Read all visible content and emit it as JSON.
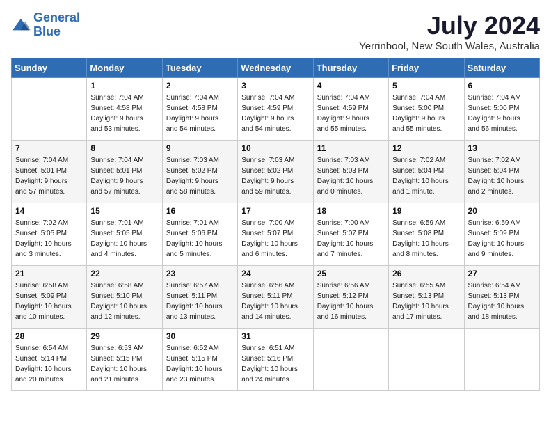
{
  "header": {
    "logo_line1": "General",
    "logo_line2": "Blue",
    "month": "July 2024",
    "location": "Yerrinbool, New South Wales, Australia"
  },
  "days_of_week": [
    "Sunday",
    "Monday",
    "Tuesday",
    "Wednesday",
    "Thursday",
    "Friday",
    "Saturday"
  ],
  "weeks": [
    [
      {
        "num": "",
        "info": ""
      },
      {
        "num": "1",
        "info": "Sunrise: 7:04 AM\nSunset: 4:58 PM\nDaylight: 9 hours\nand 53 minutes."
      },
      {
        "num": "2",
        "info": "Sunrise: 7:04 AM\nSunset: 4:58 PM\nDaylight: 9 hours\nand 54 minutes."
      },
      {
        "num": "3",
        "info": "Sunrise: 7:04 AM\nSunset: 4:59 PM\nDaylight: 9 hours\nand 54 minutes."
      },
      {
        "num": "4",
        "info": "Sunrise: 7:04 AM\nSunset: 4:59 PM\nDaylight: 9 hours\nand 55 minutes."
      },
      {
        "num": "5",
        "info": "Sunrise: 7:04 AM\nSunset: 5:00 PM\nDaylight: 9 hours\nand 55 minutes."
      },
      {
        "num": "6",
        "info": "Sunrise: 7:04 AM\nSunset: 5:00 PM\nDaylight: 9 hours\nand 56 minutes."
      }
    ],
    [
      {
        "num": "7",
        "info": "Sunrise: 7:04 AM\nSunset: 5:01 PM\nDaylight: 9 hours\nand 57 minutes."
      },
      {
        "num": "8",
        "info": "Sunrise: 7:04 AM\nSunset: 5:01 PM\nDaylight: 9 hours\nand 57 minutes."
      },
      {
        "num": "9",
        "info": "Sunrise: 7:03 AM\nSunset: 5:02 PM\nDaylight: 9 hours\nand 58 minutes."
      },
      {
        "num": "10",
        "info": "Sunrise: 7:03 AM\nSunset: 5:02 PM\nDaylight: 9 hours\nand 59 minutes."
      },
      {
        "num": "11",
        "info": "Sunrise: 7:03 AM\nSunset: 5:03 PM\nDaylight: 10 hours\nand 0 minutes."
      },
      {
        "num": "12",
        "info": "Sunrise: 7:02 AM\nSunset: 5:04 PM\nDaylight: 10 hours\nand 1 minute."
      },
      {
        "num": "13",
        "info": "Sunrise: 7:02 AM\nSunset: 5:04 PM\nDaylight: 10 hours\nand 2 minutes."
      }
    ],
    [
      {
        "num": "14",
        "info": "Sunrise: 7:02 AM\nSunset: 5:05 PM\nDaylight: 10 hours\nand 3 minutes."
      },
      {
        "num": "15",
        "info": "Sunrise: 7:01 AM\nSunset: 5:05 PM\nDaylight: 10 hours\nand 4 minutes."
      },
      {
        "num": "16",
        "info": "Sunrise: 7:01 AM\nSunset: 5:06 PM\nDaylight: 10 hours\nand 5 minutes."
      },
      {
        "num": "17",
        "info": "Sunrise: 7:00 AM\nSunset: 5:07 PM\nDaylight: 10 hours\nand 6 minutes."
      },
      {
        "num": "18",
        "info": "Sunrise: 7:00 AM\nSunset: 5:07 PM\nDaylight: 10 hours\nand 7 minutes."
      },
      {
        "num": "19",
        "info": "Sunrise: 6:59 AM\nSunset: 5:08 PM\nDaylight: 10 hours\nand 8 minutes."
      },
      {
        "num": "20",
        "info": "Sunrise: 6:59 AM\nSunset: 5:09 PM\nDaylight: 10 hours\nand 9 minutes."
      }
    ],
    [
      {
        "num": "21",
        "info": "Sunrise: 6:58 AM\nSunset: 5:09 PM\nDaylight: 10 hours\nand 10 minutes."
      },
      {
        "num": "22",
        "info": "Sunrise: 6:58 AM\nSunset: 5:10 PM\nDaylight: 10 hours\nand 12 minutes."
      },
      {
        "num": "23",
        "info": "Sunrise: 6:57 AM\nSunset: 5:11 PM\nDaylight: 10 hours\nand 13 minutes."
      },
      {
        "num": "24",
        "info": "Sunrise: 6:56 AM\nSunset: 5:11 PM\nDaylight: 10 hours\nand 14 minutes."
      },
      {
        "num": "25",
        "info": "Sunrise: 6:56 AM\nSunset: 5:12 PM\nDaylight: 10 hours\nand 16 minutes."
      },
      {
        "num": "26",
        "info": "Sunrise: 6:55 AM\nSunset: 5:13 PM\nDaylight: 10 hours\nand 17 minutes."
      },
      {
        "num": "27",
        "info": "Sunrise: 6:54 AM\nSunset: 5:13 PM\nDaylight: 10 hours\nand 18 minutes."
      }
    ],
    [
      {
        "num": "28",
        "info": "Sunrise: 6:54 AM\nSunset: 5:14 PM\nDaylight: 10 hours\nand 20 minutes."
      },
      {
        "num": "29",
        "info": "Sunrise: 6:53 AM\nSunset: 5:15 PM\nDaylight: 10 hours\nand 21 minutes."
      },
      {
        "num": "30",
        "info": "Sunrise: 6:52 AM\nSunset: 5:15 PM\nDaylight: 10 hours\nand 23 minutes."
      },
      {
        "num": "31",
        "info": "Sunrise: 6:51 AM\nSunset: 5:16 PM\nDaylight: 10 hours\nand 24 minutes."
      },
      {
        "num": "",
        "info": ""
      },
      {
        "num": "",
        "info": ""
      },
      {
        "num": "",
        "info": ""
      }
    ]
  ]
}
